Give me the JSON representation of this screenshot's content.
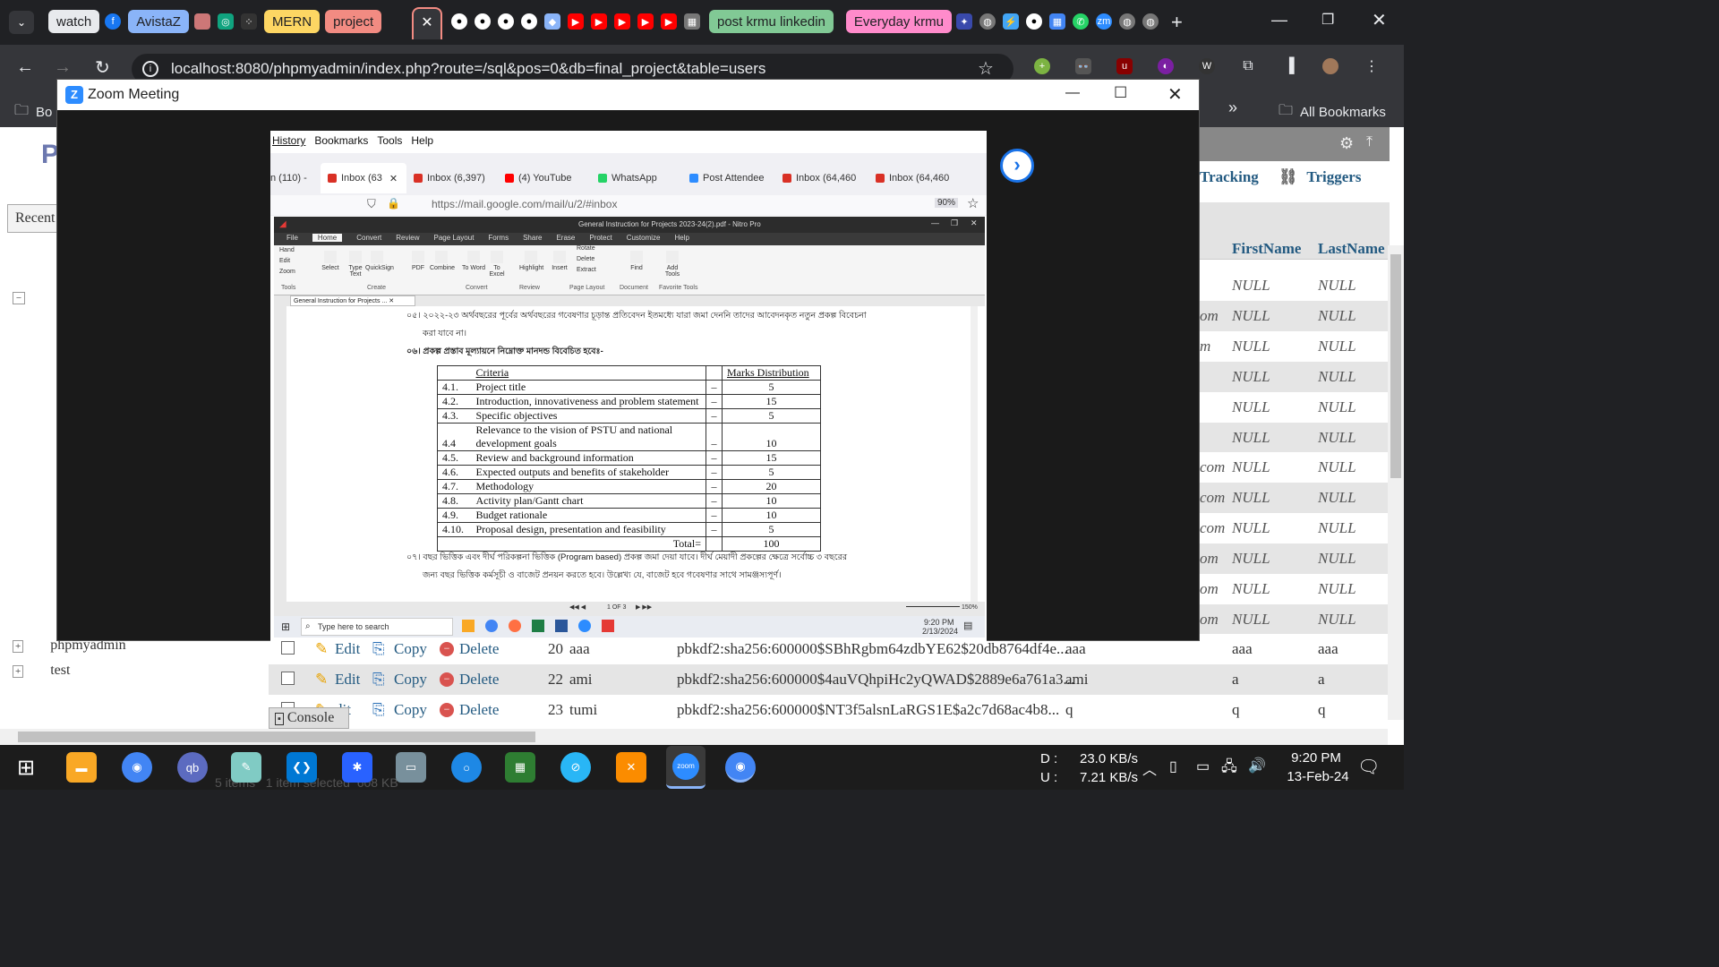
{
  "browser": {
    "tabs_chips": [
      {
        "label": "watch",
        "bg": "#e8eaed",
        "fg": "#202124"
      },
      {
        "label": "AvistaZ",
        "bg": "#8ab4f8",
        "fg": "#202124"
      },
      {
        "label": "MERN",
        "bg": "#fdd663",
        "fg": "#202124"
      },
      {
        "label": "project",
        "bg": "#f28b82",
        "fg": "#202124"
      },
      {
        "label": "post krmu linkedin",
        "bg": "#81c995",
        "fg": "#202124"
      },
      {
        "label": "Everyday krmu",
        "bg": "#ff8bcb",
        "fg": "#202124"
      }
    ],
    "active_tab_close": "✕",
    "url": "localhost:8080/phpmyadmin/index.php?route=/sql&pos=0&db=final_project&table=users",
    "bookmarks_left": "Bo",
    "all_bookmarks": "All Bookmarks",
    "chevron": "»"
  },
  "pma": {
    "recent": "Recent",
    "tree_items": [
      "phpmyadmin",
      "test"
    ],
    "tabs": [
      "Tracking",
      "Triggers"
    ],
    "columns": [
      "FirstName",
      "LastName"
    ],
    "null_rows": [
      {
        "email": "",
        "first": "NULL",
        "last": "NULL"
      },
      {
        "email": "om",
        "first": "NULL",
        "last": "NULL"
      },
      {
        "email": "m",
        "first": "NULL",
        "last": "NULL"
      },
      {
        "email": "",
        "first": "NULL",
        "last": "NULL"
      },
      {
        "email": "",
        "first": "NULL",
        "last": "NULL"
      },
      {
        "email": "",
        "first": "NULL",
        "last": "NULL"
      },
      {
        "email": "com",
        "first": "NULL",
        "last": "NULL"
      },
      {
        "email": "com",
        "first": "NULL",
        "last": "NULL"
      },
      {
        "email": "com",
        "first": "NULL",
        "last": "NULL"
      },
      {
        "email": "om",
        "first": "NULL",
        "last": "NULL"
      },
      {
        "email": "om",
        "first": "NULL",
        "last": "NULL"
      },
      {
        "email": "om",
        "first": "NULL",
        "last": "NULL"
      }
    ],
    "data_rows": [
      {
        "edit": "Edit",
        "copy": "Copy",
        "delete": "Delete",
        "id": "20",
        "user": "aaa",
        "hash": "pbkdf2:sha256:600000$SBhRgbm64zdbYE62$20db8764df4e...",
        "c1": "aaa",
        "c2": "aaa",
        "c3": "aaa"
      },
      {
        "edit": "Edit",
        "copy": "Copy",
        "delete": "Delete",
        "id": "22",
        "user": "ami",
        "hash": "pbkdf2:sha256:600000$4auVQhpiHc2yQWAD$2889e6a761a3...",
        "c1": "ami",
        "c2": "a",
        "c3": "a"
      },
      {
        "edit": "dit",
        "copy": "Copy",
        "delete": "Delete",
        "id": "23",
        "user": "tumi",
        "hash": "pbkdf2:sha256:600000$NT3f5alsnLaRGS1E$a2c7d68ac4b8...",
        "c1": "q",
        "c2": "q",
        "c3": "q"
      }
    ],
    "console": "Console"
  },
  "zoom": {
    "title": "Zoom Meeting",
    "firefox_menu": [
      "History",
      "Bookmarks",
      "Tools",
      "Help"
    ],
    "firefox_tabs": [
      "n (110) -",
      "Inbox (63",
      "Inbox (6,397)",
      "(4) YouTube",
      "WhatsApp",
      "Post Attendee",
      "Inbox (64,460",
      "Inbox (64,460"
    ],
    "firefox_url": "https://mail.google.com/mail/u/2/#inbox",
    "zoom_pct": "90%",
    "nitro_title": "General Instruction for Projects 2023-24(2).pdf - Nitro Pro",
    "ribbon_tabs": [
      "File",
      "Home",
      "Convert",
      "Review",
      "Page Layout",
      "Forms",
      "Share",
      "Erase",
      "Protect",
      "Customize",
      "Help"
    ],
    "ribbon_tools": [
      "Hand",
      "Edit",
      "Zoom",
      "Select",
      "Type Text",
      "QuickSign",
      "PDF",
      "Combine",
      "To Word",
      "To Excel",
      "Highlight",
      "Insert",
      "Rotate",
      "Delete",
      "Extract",
      "Find",
      "Add Tools"
    ],
    "ribbon_groups": [
      "Tools",
      "Create",
      "Convert",
      "Review",
      "Page Layout",
      "Document",
      "Favorite Tools"
    ],
    "doc_tab": "General Instruction for Projects ...",
    "doc_lines": [
      "০৫। ২০২২-২৩ অর্থবছরের পূর্বের অর্থবছরের গবেষণার চূড়ান্ত প্রতিবেদন ইতমধ্যে যারা জমা দেননি তাদের আবেদনকৃত নতুন প্রকল্প বিবেচনা",
      "করা যাবে না।",
      "০৬। প্রকল্প প্রস্তাব মূল্যায়নে নিম্নোক্ত মানদন্ড বিবেচিত হবেঃ-"
    ],
    "table_header": [
      "Criteria",
      "Marks Distribution"
    ],
    "table_rows": [
      {
        "no": "4.1.",
        "c": "Project title",
        "m": "5"
      },
      {
        "no": "4.2.",
        "c": "Introduction, innovativeness and problem statement",
        "m": "15"
      },
      {
        "no": "4.3.",
        "c": "Specific objectives",
        "m": "5"
      },
      {
        "no": "4.4",
        "c": "Relevance to the vision of PSTU and national development goals",
        "m": "10"
      },
      {
        "no": "4.5.",
        "c": "Review and background information",
        "m": "15"
      },
      {
        "no": "4.6.",
        "c": "Expected outputs and benefits of stakeholder",
        "m": "5"
      },
      {
        "no": "4.7.",
        "c": "Methodology",
        "m": "20"
      },
      {
        "no": "4.8.",
        "c": "Activity plan/Gantt chart",
        "m": "10"
      },
      {
        "no": "4.9.",
        "c": "Budget rationale",
        "m": "10"
      },
      {
        "no": "4.10.",
        "c": "Proposal design, presentation and feasibility",
        "m": "5"
      }
    ],
    "total_label": "Total=",
    "total_value": "100",
    "doc_lines_after": [
      "০৭। বছর ভিত্তিক এবং দীর্ঘ পরিকল্পনা ভিত্তিক (Program based) প্রকল্প জমা দেয়া যাবে। দীর্ঘ মেয়াদী প্রকল্পের ক্ষেত্রে সর্বোচ্চ ৩ বছরের",
      "জন্য বছর ভিত্তিক কর্মসূচী ও বাজেট প্রনয়ন করতে হবে। উল্লেখ্য যে, বাজেট হবে গবেষণার সাথে সামঞ্জস্যপূর্ণ।"
    ],
    "page_indicator": "1 OF 3",
    "doc_zoom": "150%",
    "inner_search": "Type here to search",
    "inner_time": "9:20 PM",
    "inner_date": "2/13/2024"
  },
  "taskbar": {
    "net_down_label": "D :",
    "net_down": "23.0 KB/s",
    "net_up_label": "U :",
    "net_up": "7.21 KB/s",
    "time": "9:20 PM",
    "date": "13-Feb-24",
    "explorer_status": "5 items   1 item selected  608 KB"
  }
}
